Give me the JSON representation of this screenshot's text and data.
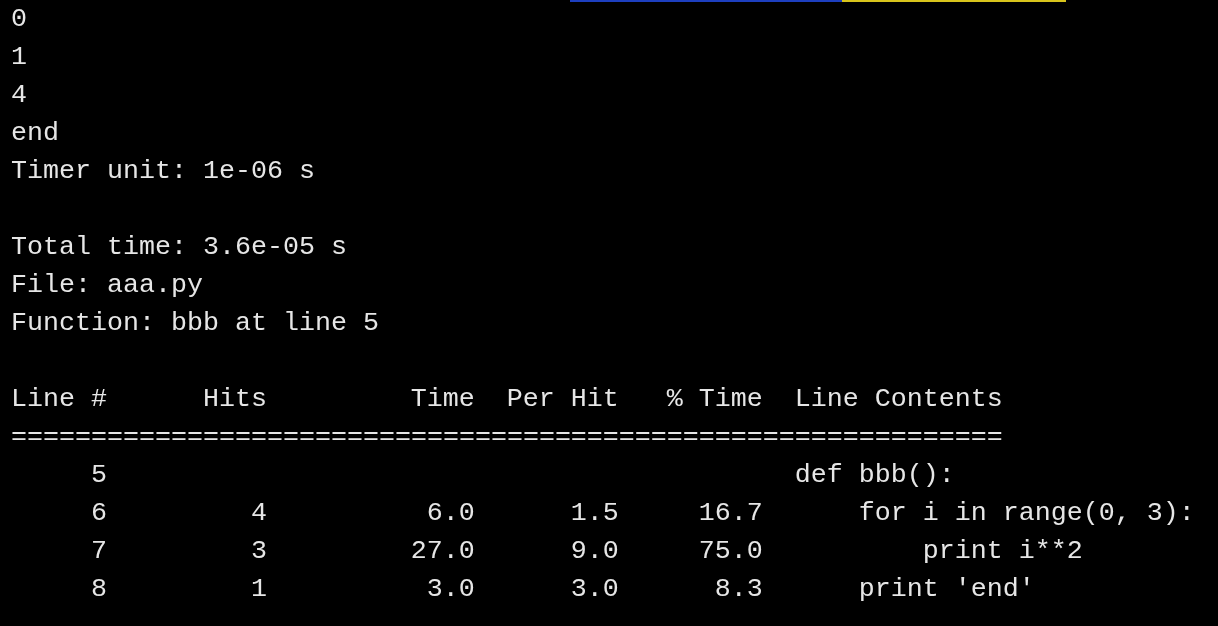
{
  "output_blocks": [
    [
      "0",
      "1",
      "4",
      "end",
      "Timer unit: 1e-06 s"
    ],
    [
      "Total time: 3.6e-05 s",
      "File: aaa.py",
      "Function: bbb at line 5"
    ]
  ],
  "table": {
    "columns": [
      "Line #",
      "Hits",
      "Time",
      "Per Hit",
      "% Time",
      "Line Contents"
    ],
    "rule": "==============================================================",
    "rows": [
      {
        "cells": [
          "5",
          "",
          "",
          "",
          "",
          "def bbb():"
        ]
      },
      {
        "cells": [
          "6",
          "4",
          "6.0",
          "1.5",
          "16.7",
          "    for i in range(0, 3):"
        ]
      },
      {
        "cells": [
          "7",
          "3",
          "27.0",
          "9.0",
          "75.0",
          "        print i**2"
        ]
      },
      {
        "cells": [
          "8",
          "1",
          "3.0",
          "3.0",
          "8.3",
          "    print 'end'"
        ]
      }
    ]
  }
}
